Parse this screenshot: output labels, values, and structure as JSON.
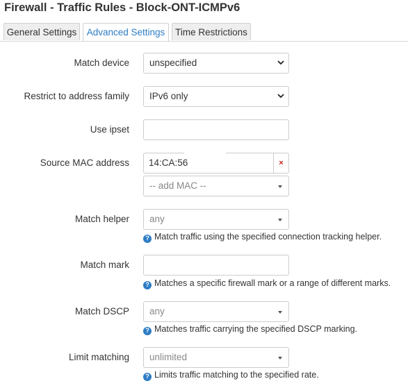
{
  "page": {
    "title": "Firewall - Traffic Rules - Block-ONT-ICMPv6"
  },
  "tabs": [
    {
      "label": "General Settings",
      "active": false
    },
    {
      "label": "Advanced Settings",
      "active": true
    },
    {
      "label": "Time Restrictions",
      "active": false
    }
  ],
  "fields": {
    "match_device": {
      "label": "Match device",
      "value": "unspecified"
    },
    "address_family": {
      "label": "Restrict to address family",
      "value": "IPv6 only"
    },
    "use_ipset": {
      "label": "Use ipset",
      "value": ""
    },
    "source_mac": {
      "label": "Source MAC address",
      "value": "14:CA:56",
      "remove": "×",
      "add_placeholder": "-- add MAC --"
    },
    "match_helper": {
      "label": "Match helper",
      "value": "any",
      "help": "Match traffic using the specified connection tracking helper."
    },
    "match_mark": {
      "label": "Match mark",
      "value": "",
      "help": "Matches a specific firewall mark or a range of different marks."
    },
    "match_dscp": {
      "label": "Match DSCP",
      "value": "any",
      "help": "Matches traffic carrying the specified DSCP marking."
    },
    "limit_matching": {
      "label": "Limit matching",
      "value": "unlimited",
      "help": "Limits traffic matching to the specified rate."
    }
  },
  "help_icon_glyph": "?",
  "colors": {
    "accent": "#2e7dc4",
    "remove": "#cc2222",
    "border": "#cccccc"
  }
}
